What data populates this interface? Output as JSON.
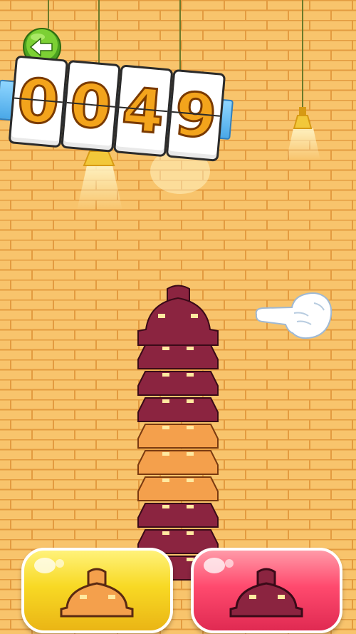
{
  "score": {
    "digits": [
      "0",
      "0",
      "4",
      "9"
    ]
  },
  "controls": {
    "back_icon": "arrow-left-icon",
    "left_piece_color": "#f4a04c",
    "right_piece_color": "#8b2440"
  },
  "tower": {
    "layer_colors_top_to_bottom": [
      "#8b2440",
      "#8b2440",
      "#8b2440",
      "#8b2440",
      "#f4a04c",
      "#f4a04c",
      "#f4a04c",
      "#8b2440",
      "#8b2440",
      "#8b2440"
    ]
  },
  "colors": {
    "wall": "#f8c46c",
    "mortar": "#e59a3c",
    "lamp": "#f2c83a"
  }
}
